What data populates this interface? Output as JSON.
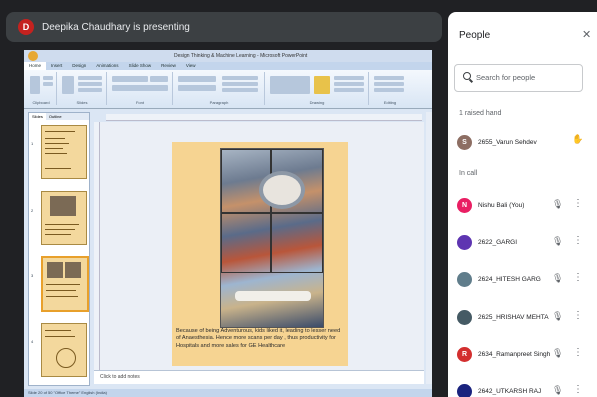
{
  "presenter": {
    "initial": "D",
    "banner": "Deepika Chaudhary is presenting"
  },
  "ppt": {
    "window_title": "Design Thinking & Machine Learning - Microsoft PowerPoint",
    "tabs": [
      "Home",
      "Insert",
      "Design",
      "Animations",
      "Slide Show",
      "Review",
      "View"
    ],
    "ribbon_groups": [
      "Clipboard",
      "Slides",
      "Font",
      "Paragraph",
      "Drawing",
      "Editing"
    ],
    "pane_tabs": [
      "Slides",
      "Outline"
    ],
    "slide_numbers": [
      "1",
      "2",
      "3",
      "4"
    ],
    "caption": "Because of being Adventurous, kids liked it, leading to lesser need of Anaesthesia. Hence more scans per day , thus productivity for Hospitals and more sales for GE Healthcare",
    "notes_placeholder": "Click to add notes",
    "status": "Slide 20 of 50    \"Office Theme\"    English (India)"
  },
  "people_panel": {
    "title": "People",
    "close_icon": "close-icon",
    "search_placeholder": "Search for people",
    "raised_hand_header": "1 raised hand",
    "in_call_header": "In call",
    "raised": {
      "initial": "S",
      "name": "2655_Varun Sehdev",
      "color": "#8d6e63",
      "icon": "hand-raised-icon"
    },
    "participants": [
      {
        "initial": "N",
        "name": "Nishu Bali (You)",
        "color": "#e91e63",
        "mic_icon": "mic-off-icon",
        "more_icon": "more-vert-icon"
      },
      {
        "initial": "",
        "name": "2622_GARGI",
        "color": "#5e35b1",
        "mic_icon": "mic-off-icon",
        "more_icon": "more-vert-icon"
      },
      {
        "initial": "",
        "name": "2624_HITESH GARG",
        "color": "#607d8b",
        "mic_icon": "mic-off-icon",
        "more_icon": "more-vert-icon"
      },
      {
        "initial": "",
        "name": "2625_HRISHAV MEHTA",
        "color": "#455a64",
        "mic_icon": "mic-off-icon",
        "more_icon": "more-vert-icon"
      },
      {
        "initial": "R",
        "name": "2634_Ramanpreet Singh",
        "color": "#d32f2f",
        "mic_icon": "mic-off-icon",
        "more_icon": "more-vert-icon"
      },
      {
        "initial": "",
        "name": "2642_UTKARSH RAJ",
        "color": "#1a237e",
        "mic_icon": "mic-off-icon",
        "more_icon": "more-vert-icon"
      }
    ]
  }
}
